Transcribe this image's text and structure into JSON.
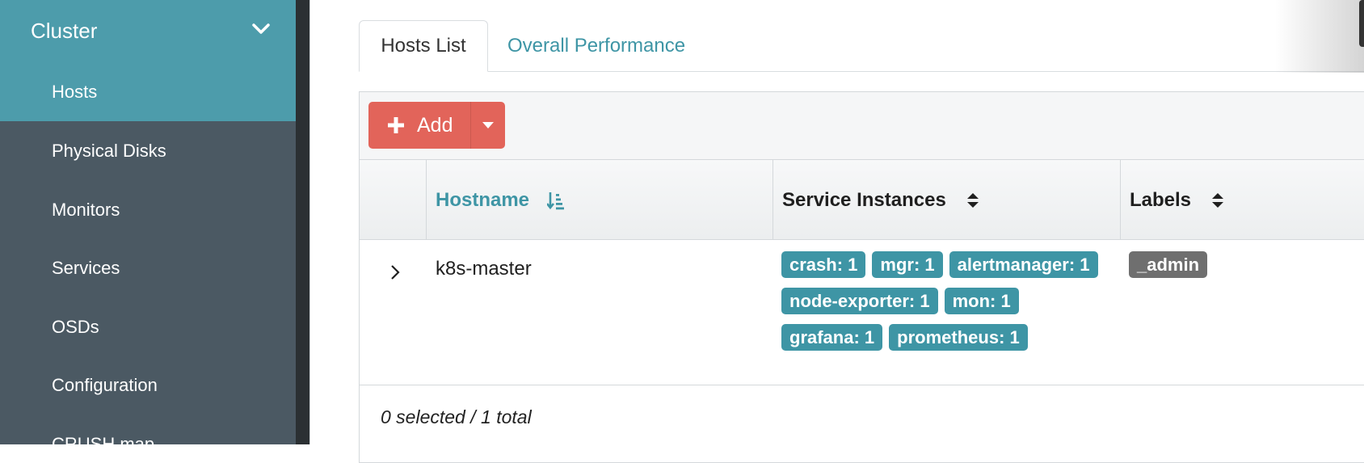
{
  "sidebar": {
    "section_label": "Cluster",
    "items": [
      {
        "label": "Hosts",
        "active": true
      },
      {
        "label": "Physical Disks"
      },
      {
        "label": "Monitors"
      },
      {
        "label": "Services"
      },
      {
        "label": "OSDs"
      },
      {
        "label": "Configuration"
      },
      {
        "label": "CRUSH map"
      }
    ]
  },
  "tabs": [
    {
      "label": "Hosts List",
      "active": true
    },
    {
      "label": "Overall Performance",
      "active": false
    }
  ],
  "toolbar": {
    "add_label": "Add"
  },
  "table": {
    "columns": [
      "Hostname",
      "Service Instances",
      "Labels"
    ],
    "rows": [
      {
        "hostname": "k8s-master",
        "services": [
          "crash: 1",
          "mgr: 1",
          "alertmanager: 1",
          "node-exporter: 1",
          "mon: 1",
          "grafana: 1",
          "prometheus: 1"
        ],
        "labels": [
          "_admin"
        ]
      }
    ],
    "footer": "0 selected / 1 total"
  },
  "colors": {
    "sidebar_bg": "#4b5963",
    "sidebar_active": "#4d9cab",
    "accent": "#3e95a5",
    "add_button": "#e2645a",
    "label_badge": "#6f6f6f"
  }
}
